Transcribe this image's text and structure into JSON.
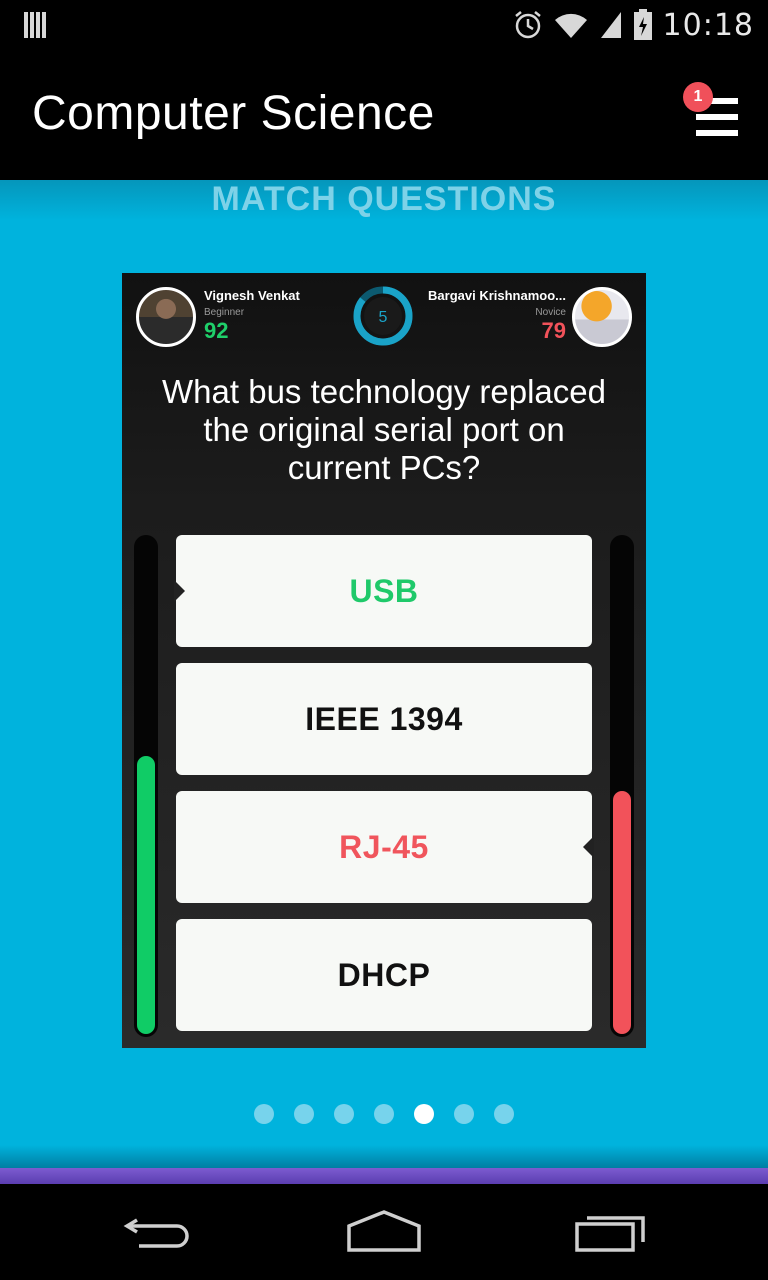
{
  "status_bar": {
    "time": "10:18",
    "icons": [
      "storage-icon",
      "alarm-icon",
      "wifi-icon",
      "signal-icon",
      "battery-icon"
    ]
  },
  "app_bar": {
    "title": "Computer Science",
    "notification_count": "1"
  },
  "section": {
    "title": "MATCH QUESTIONS"
  },
  "match": {
    "player_left": {
      "name": "Vignesh Venkat",
      "level": "Beginner",
      "score": "92",
      "progress": 0.56
    },
    "player_right": {
      "name": "Bargavi Krishnamoo...",
      "level": "Novice",
      "score": "79",
      "progress": 0.49
    },
    "timer": "5",
    "question": "What bus technology replaced the original serial port on current PCs?",
    "answers": [
      {
        "label": "USB",
        "state": "correct"
      },
      {
        "label": "IEEE 1394",
        "state": "neutral"
      },
      {
        "label": "RJ-45",
        "state": "wrong"
      },
      {
        "label": "DHCP",
        "state": "neutral"
      }
    ]
  },
  "pagination": {
    "total": 7,
    "active_index": 4
  },
  "colors": {
    "background": "#00b3dd",
    "correct": "#1fc96a",
    "wrong": "#f0555c",
    "timer_ring": "#1aa3c8"
  },
  "nav_bar": {
    "icons": [
      "back-icon",
      "home-icon",
      "recent-apps-icon"
    ]
  }
}
